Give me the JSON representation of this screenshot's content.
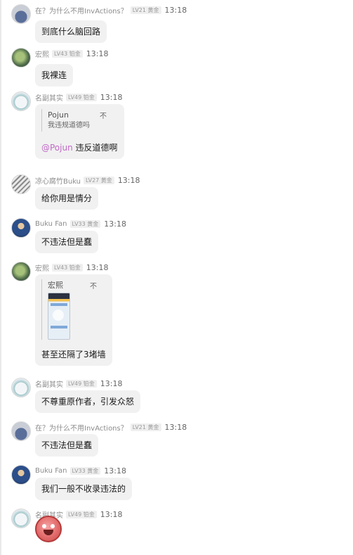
{
  "messages": [
    {
      "user": "在？为什么不用InvActions？",
      "level": "LV21 黄金",
      "time": "13:18",
      "text": "到底什么脑回路",
      "avatar": "blue-creature-avatar"
    },
    {
      "user": "宏熙",
      "level": "LV43 铂金",
      "time": "13:18",
      "text": "我裸连",
      "avatar": "green-character-avatar"
    },
    {
      "user": "名副其实",
      "level": "LV49 铂金",
      "time": "13:18",
      "quote_user": "Pojun",
      "quote_text": "我违规道德吗",
      "quote_more": "不",
      "mention": "@Pojun",
      "text": " 违反道德啊",
      "avatar": "white-hair-avatar"
    },
    {
      "user": "凉心腐竹Buku",
      "level": "LV27 黄金",
      "time": "13:18",
      "text": "给你用是情分",
      "avatar": "manga-avatar"
    },
    {
      "user": "Buku Fan",
      "level": "LV33 黄金",
      "time": "13:18",
      "text": "不违法但是蠢",
      "avatar": "blue-ninja-avatar"
    },
    {
      "user": "宏熙",
      "level": "LV43 铂金",
      "time": "13:18",
      "quote_user": "宏熙",
      "quote_more": "不",
      "text": "甚至还隔了3堵墙",
      "avatar": "green-character-avatar"
    },
    {
      "user": "名副其实",
      "level": "LV49 铂金",
      "time": "13:18",
      "text": "不尊重原作者，引发众怒",
      "avatar": "white-hair-avatar"
    },
    {
      "user": "在？为什么不用InvActions？",
      "level": "LV21 黄金",
      "time": "13:18",
      "text": "不违法但是蠢",
      "avatar": "blue-creature-avatar"
    },
    {
      "user": "Buku Fan",
      "level": "LV33 黄金",
      "time": "13:18",
      "text": "我们一般不收录违法的",
      "avatar": "blue-ninja-avatar"
    },
    {
      "user": "名副其实",
      "level": "LV49 铂金",
      "time": "13:18",
      "sticker": "smiling-face-sticker",
      "avatar": "white-hair-avatar"
    }
  ]
}
